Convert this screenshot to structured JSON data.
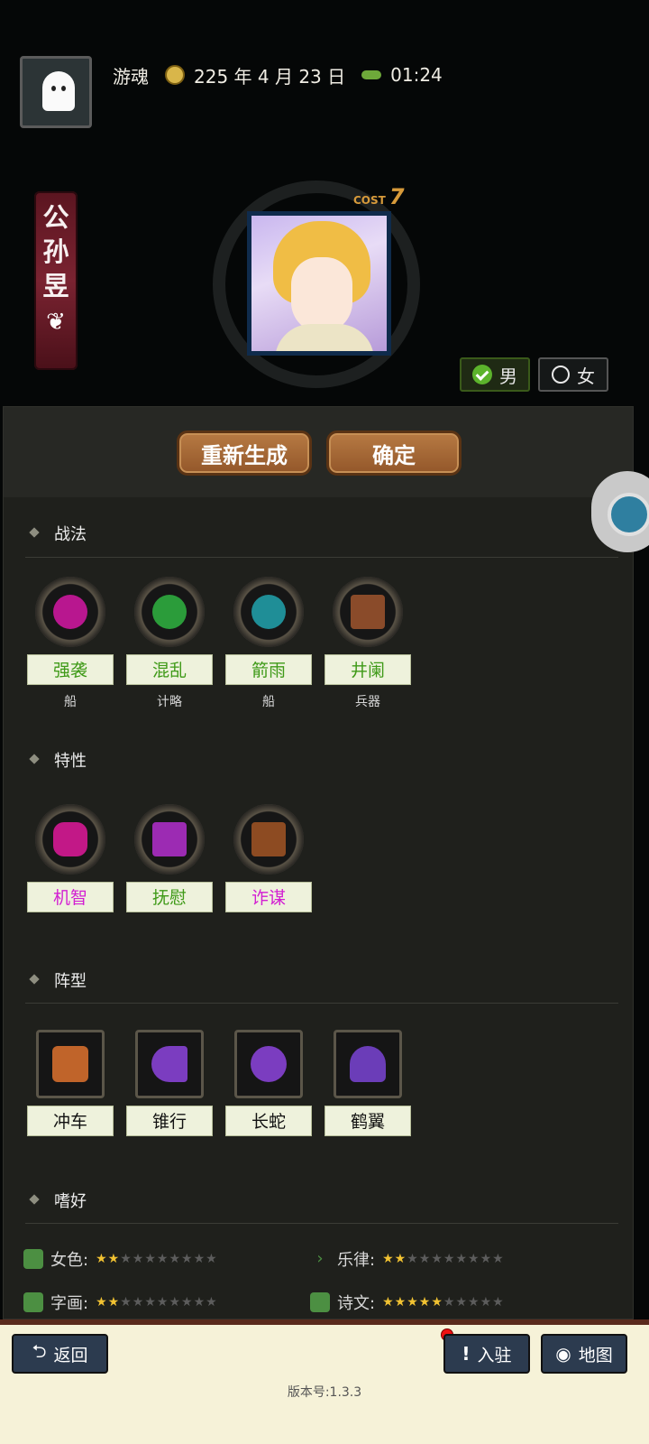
{
  "header": {
    "player_name": "游魂",
    "date": "225 年 4 月 23 日",
    "time": "01:24",
    "date_icon": "sun-icon",
    "time_icon": "bug-icon"
  },
  "hero": {
    "name_chars": [
      "公",
      "孙",
      "昱"
    ],
    "cost_label": "COST",
    "cost_value": "7",
    "gender_male": "男",
    "gender_female": "女",
    "selected_gender": "男"
  },
  "actions": {
    "regenerate": "重新生成",
    "confirm": "确定"
  },
  "sections": {
    "tactics": "战法",
    "traits": "特性",
    "formations": "阵型",
    "hobbies": "嗜好"
  },
  "tactics": [
    {
      "name": "强袭",
      "type": "船",
      "color": "#b8178f"
    },
    {
      "name": "混乱",
      "type": "计略",
      "color": "#2b9c3a"
    },
    {
      "name": "箭雨",
      "type": "船",
      "color": "#1f8e97"
    },
    {
      "name": "井阑",
      "type": "兵器",
      "color": "#8a4b2a"
    }
  ],
  "traits": [
    {
      "name": "机智",
      "color": "#c21887"
    },
    {
      "name": "抚慰",
      "color": "#9c2bb3"
    },
    {
      "name": "诈谋",
      "color": "#8d4b22"
    }
  ],
  "formations": [
    {
      "name": "冲车",
      "color": "#c0642a"
    },
    {
      "name": "锥行",
      "color": "#7b3dc0"
    },
    {
      "name": "长蛇",
      "color": "#7b3dc0"
    },
    {
      "name": "鹤翼",
      "color": "#6b3db8"
    }
  ],
  "hobbies": [
    {
      "label": "女色:",
      "rating": 2,
      "max": 10,
      "icon": "sandals-icon"
    },
    {
      "label": "乐律:",
      "rating": 2,
      "max": 10,
      "icon": "music-icon"
    },
    {
      "label": "字画:",
      "rating": 1.5,
      "max": 10,
      "icon": "scroll-icon"
    },
    {
      "label": "诗文:",
      "rating": 4.5,
      "max": 10,
      "icon": "book-icon"
    }
  ],
  "footer": {
    "back": "返回",
    "station": "入驻",
    "map": "地图",
    "version": "版本号:1.3.3"
  }
}
